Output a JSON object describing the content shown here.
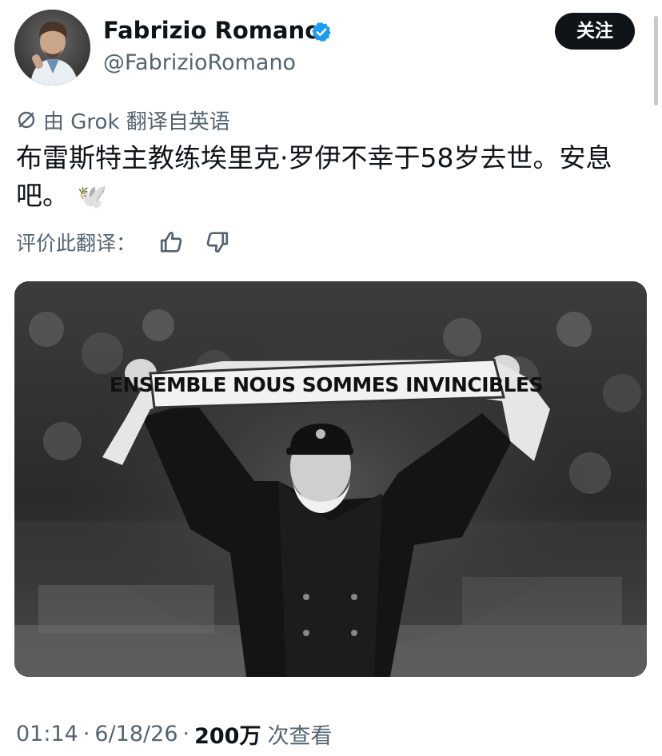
{
  "author": {
    "display_name": "Fabrizio Romano",
    "handle": "@FabrizioRomano",
    "verified": true,
    "verified_color": "#1d9bf0"
  },
  "follow_button": {
    "label": "关注"
  },
  "translation": {
    "label": "由 Grok 翻译自英语",
    "icon": "translate-icon",
    "rate_label": "评价此翻译："
  },
  "tweet": {
    "text": "布雷斯特主教练埃里克·罗伊不幸于58岁去世。安息吧。",
    "emoji": "🕊️"
  },
  "media": {
    "scarf_text": "ENSEMBLE NOUS SOMMES INVINCIBLES"
  },
  "meta": {
    "time": "01:14",
    "date": "6/18/26",
    "views_count": "200万",
    "views_label": "次查看"
  },
  "colors": {
    "text_primary": "#0f1419",
    "text_secondary": "#536471",
    "button_bg": "#0f1419"
  }
}
